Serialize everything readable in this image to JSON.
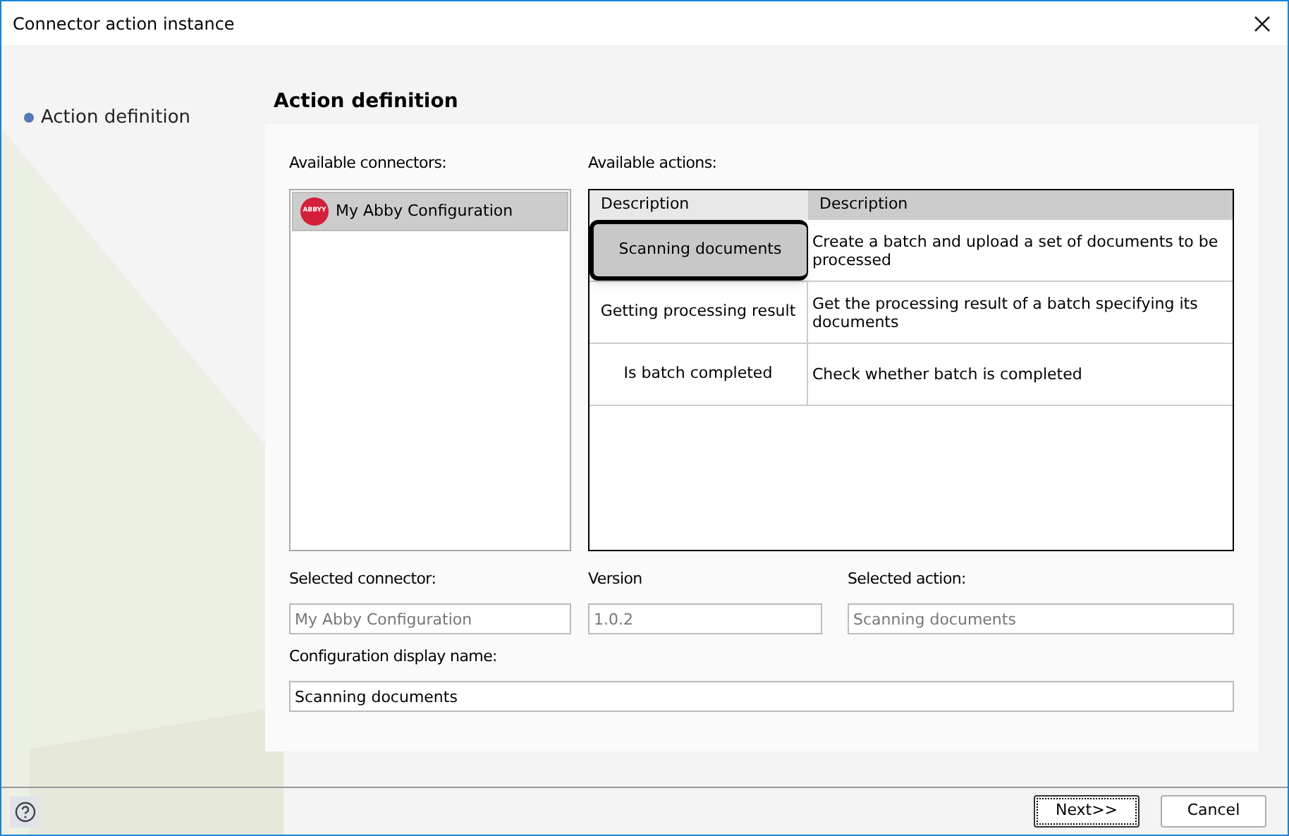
{
  "window": {
    "title": "Connector action instance"
  },
  "steps": [
    {
      "label": "Action definition",
      "selected": true
    }
  ],
  "heading": "Action definition",
  "connectors": {
    "label": "Available connectors:",
    "items": [
      {
        "name": "My Abby Configuration",
        "logo": "ABBYY",
        "selected": true
      }
    ]
  },
  "actions": {
    "label": "Available actions:",
    "columns": [
      "Description",
      "Description"
    ],
    "rows": [
      {
        "name": "Scanning documents",
        "description": "Create a batch and upload a set of documents to be processed",
        "selected": true
      },
      {
        "name": "Getting processing result",
        "description": "Get the processing result of a batch specifying its documents",
        "selected": false
      },
      {
        "name": "Is batch completed",
        "description": "Check whether batch is completed",
        "selected": false
      }
    ]
  },
  "fields": [
    {
      "label": "Selected connector:",
      "value": "My Abby Configuration",
      "disabled": true
    },
    {
      "label": "Version",
      "value": "1.0.2",
      "disabled": true
    },
    {
      "label": "Selected action:",
      "value": "Scanning documents",
      "disabled": true
    }
  ],
  "display_name": {
    "label": "Configuration display name:",
    "value": "Scanning documents",
    "disabled": false
  },
  "buttons": [
    {
      "label": "Next>>",
      "focused": true
    },
    {
      "label": "Cancel",
      "focused": false
    }
  ]
}
